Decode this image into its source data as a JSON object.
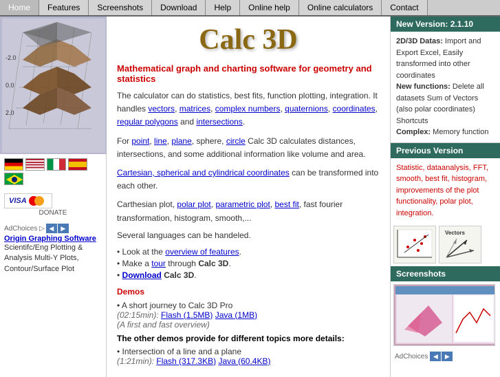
{
  "nav": {
    "items": [
      {
        "label": "Home",
        "active": true
      },
      {
        "label": "Features",
        "active": false
      },
      {
        "label": "Screenshots",
        "active": false
      },
      {
        "label": "Download",
        "active": false
      },
      {
        "label": "Help",
        "active": false
      },
      {
        "label": "Online help",
        "active": false
      },
      {
        "label": "Online calculators",
        "active": false
      },
      {
        "label": "Contact",
        "active": false
      }
    ]
  },
  "page": {
    "title": "Calc 3D"
  },
  "main": {
    "headline": "Mathematical graph and charting software for geometry and statistics",
    "intro": "The calculator can do statistics, best fits, function plotting, integration. It handles",
    "intro_links": [
      "vectors",
      "matrices",
      "complex numbers",
      "quaternions",
      "coordinates",
      "regular polygons",
      "intersections"
    ],
    "features_line1": "For",
    "features_links": [
      "point",
      "line",
      "plane"
    ],
    "features_line2": "sphere, circle Calc 3D calculates distances, intersections, and some additional information like volume and area.",
    "coords_link": "Cartesian, spherical and cylindrical coordinates",
    "coords_text": "can be transformed into each other.",
    "plot_text": "Carthesian plot,",
    "plot_links": [
      "polar plot",
      "parametric plot",
      "best fit"
    ],
    "plot_suffix": "fast fourier transformation, histogram, smooth,...",
    "languages": "Several languages can be handeled.",
    "bullets": [
      {
        "text": "Look at the",
        "link": "overview of features",
        "suffix": "."
      },
      {
        "text": "Make a",
        "link": "tour",
        "suffix": "through Calc 3D."
      },
      {
        "text": "Download Calc 3D.",
        "link": "Download",
        "bold": true
      }
    ],
    "demos_label": "Demos",
    "demo1_text": "A short journey to Calc 3D Pro",
    "demo1_time": "(02:15min):",
    "demo1_flash": "Flash (1.5MB)",
    "demo1_java": "Java (1MB)",
    "demo1_note": "(A first and fast overview)",
    "demo2_header": "The other demos provide for different topics more details:",
    "demo2_text": "• Intersection of a line and a plane",
    "demo2_time": "(1:21min):",
    "demo2_flash": "Flash (317.3KB)",
    "demo2_java": "Java (60.4KB)"
  },
  "right_sidebar": {
    "new_version_header": "New Version: 2.1.10",
    "new_version_content": "2D/3D Datas: Import and Export Excel, Easily transformed into other coordinates\nNew functions: Delete all datasets Sum of Vectors (also polar coordinates) Shortcuts\nComplex: Memory function",
    "new_functions_label": "New functions:",
    "prev_version_header": "Previous Version",
    "prev_version_content": "Statistic, dataanalysis, FFT, smooth, best fit, histogram, improvements of the plot functionality, polar plot, integration.",
    "screenshots_header": "Screenshots",
    "vectors_label": "Vectors",
    "ad_choices": "AdChoices"
  },
  "left_sidebar": {
    "ad_choices": "AdChoices ▷",
    "ad_link": "Origin Graphing Software",
    "ad_desc": "Scientifc/Eng Plotting & Analysis Multi-Y Plots, Contour/Surface Plot",
    "donate_text": "DONATE"
  }
}
